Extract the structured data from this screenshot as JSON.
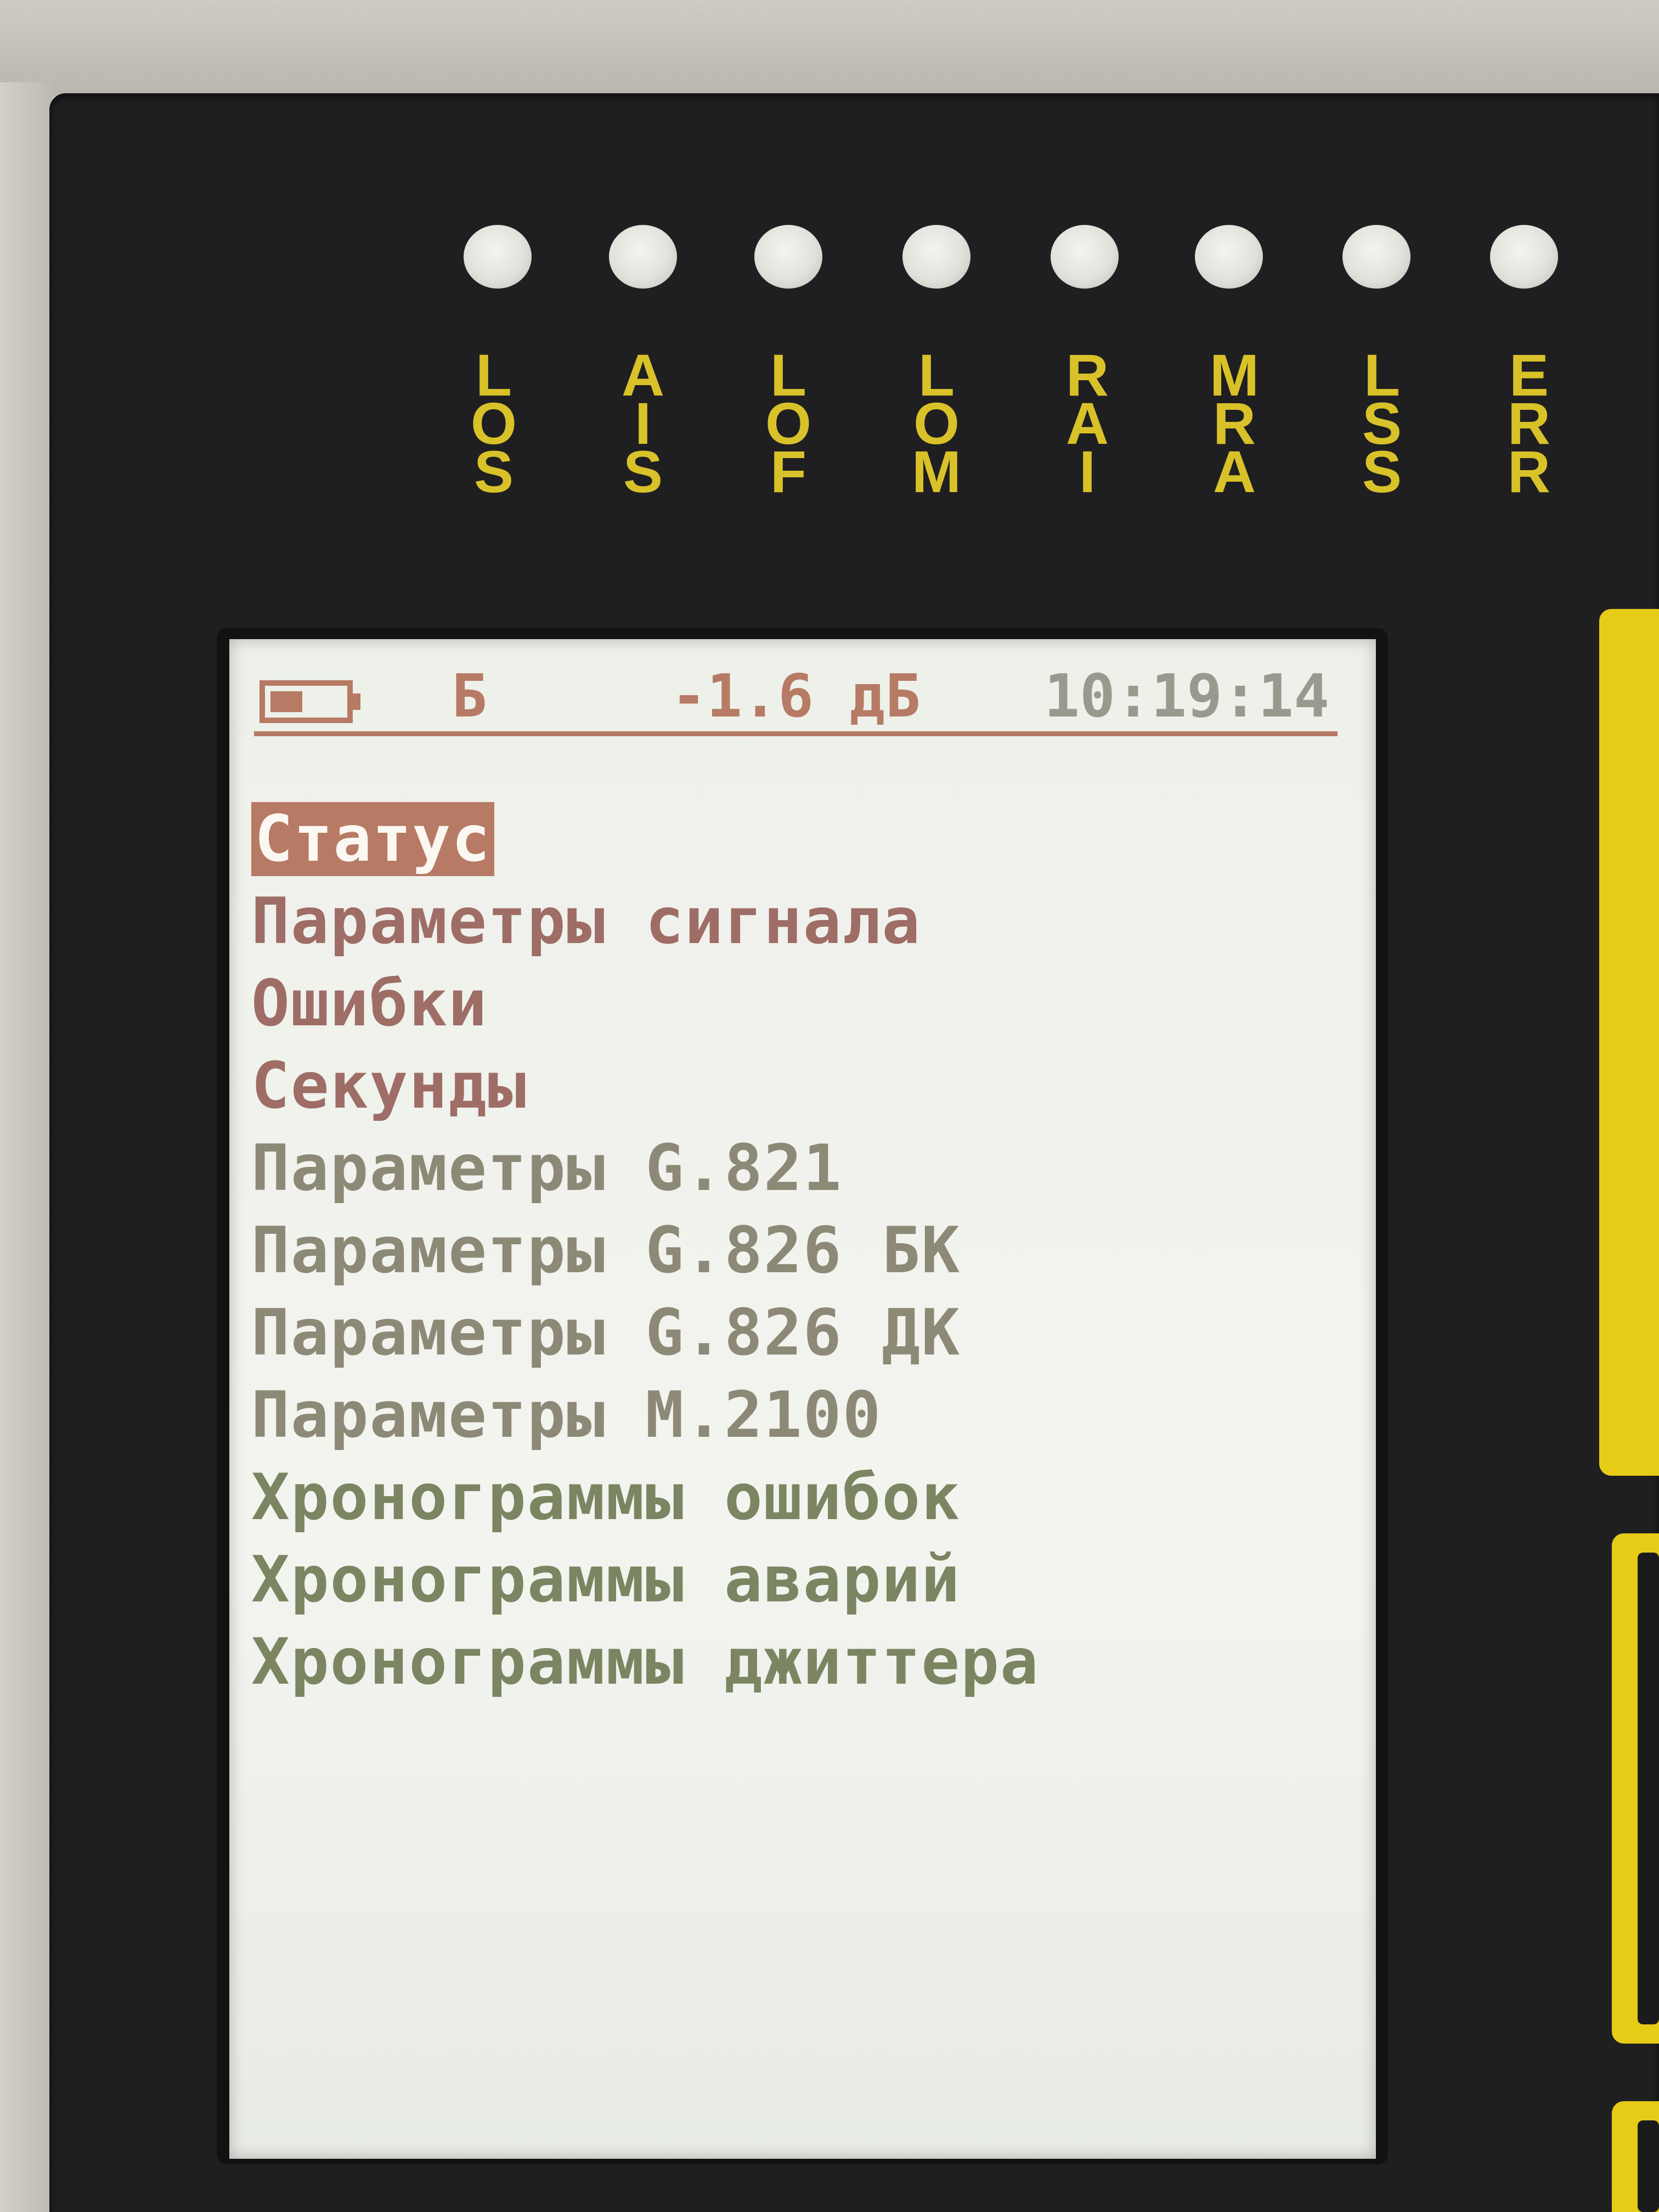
{
  "leds": [
    {
      "label": [
        "L",
        "O",
        "S"
      ]
    },
    {
      "label": [
        "A",
        "I",
        "S"
      ]
    },
    {
      "label": [
        "L",
        "O",
        "F"
      ]
    },
    {
      "label": [
        "L",
        "O",
        "M"
      ]
    },
    {
      "label": [
        "R",
        "A",
        "I"
      ]
    },
    {
      "label": [
        "M",
        "R",
        "A"
      ]
    },
    {
      "label": [
        "L",
        "S",
        "S"
      ]
    },
    {
      "label": [
        "E",
        "R",
        "R"
      ]
    }
  ],
  "status_bar": {
    "battery_icon": "battery-icon",
    "mode": "Б",
    "level": "-1.6 дБ",
    "time": "10:19:14"
  },
  "menu": {
    "selected_index": 0,
    "items": [
      {
        "label": "Статус"
      },
      {
        "label": "Параметры сигнала"
      },
      {
        "label": "Ошибки"
      },
      {
        "label": "Секунды"
      },
      {
        "label": "Параметры G.821"
      },
      {
        "label": "Параметры G.826 БК"
      },
      {
        "label": "Параметры G.826 ДК"
      },
      {
        "label": "Параметры M.2100"
      },
      {
        "label": "Хронограммы ошибок"
      },
      {
        "label": "Хронограммы аварий"
      },
      {
        "label": "Хронограммы джиттера"
      }
    ]
  },
  "colors": {
    "led_label": "#d9c229",
    "highlight": "#b77a64",
    "panel": "#1f1f21",
    "key": "#e6cc17"
  }
}
